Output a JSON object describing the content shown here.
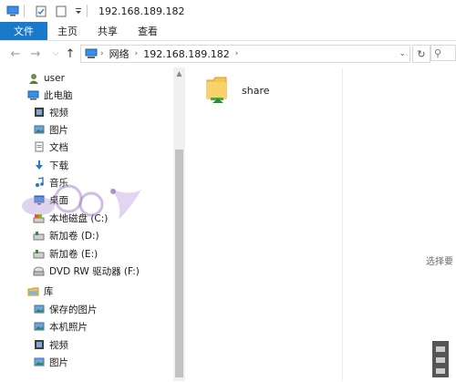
{
  "window": {
    "title": "192.168.189.182"
  },
  "ribbon": {
    "tabs": [
      {
        "label": "文件",
        "active": true
      },
      {
        "label": "主页"
      },
      {
        "label": "共享"
      },
      {
        "label": "查看"
      }
    ]
  },
  "address": {
    "segments": [
      "网络",
      "192.168.189.182"
    ]
  },
  "sidebar": {
    "items": [
      {
        "label": "user",
        "icon": "user-icon"
      },
      {
        "label": "此电脑",
        "icon": "computer-icon"
      },
      {
        "label": "视频",
        "icon": "video-folder-icon"
      },
      {
        "label": "图片",
        "icon": "picture-folder-icon"
      },
      {
        "label": "文档",
        "icon": "document-folder-icon"
      },
      {
        "label": "下载",
        "icon": "download-folder-icon"
      },
      {
        "label": "音乐",
        "icon": "music-folder-icon"
      },
      {
        "label": "桌面",
        "icon": "desktop-folder-icon"
      },
      {
        "label": "本地磁盘 (C:)",
        "icon": "local-disk-icon"
      },
      {
        "label": "新加卷 (D:)",
        "icon": "drive-icon"
      },
      {
        "label": "新加卷 (E:)",
        "icon": "drive-icon"
      },
      {
        "label": "DVD RW 驱动器 (F:)",
        "icon": "dvd-drive-icon"
      },
      {
        "label": "库",
        "icon": "library-icon"
      },
      {
        "label": "保存的图片",
        "icon": "saved-pictures-icon"
      },
      {
        "label": "本机照片",
        "icon": "camera-roll-icon"
      },
      {
        "label": "视频",
        "icon": "video-folder-icon"
      },
      {
        "label": "图片",
        "icon": "picture-folder-icon"
      }
    ]
  },
  "content": {
    "items": [
      {
        "label": "share",
        "icon": "shared-folder-icon"
      }
    ],
    "hint": "选择要"
  },
  "colors": {
    "accent": "#1979ca",
    "folder": "#f4c64f"
  }
}
